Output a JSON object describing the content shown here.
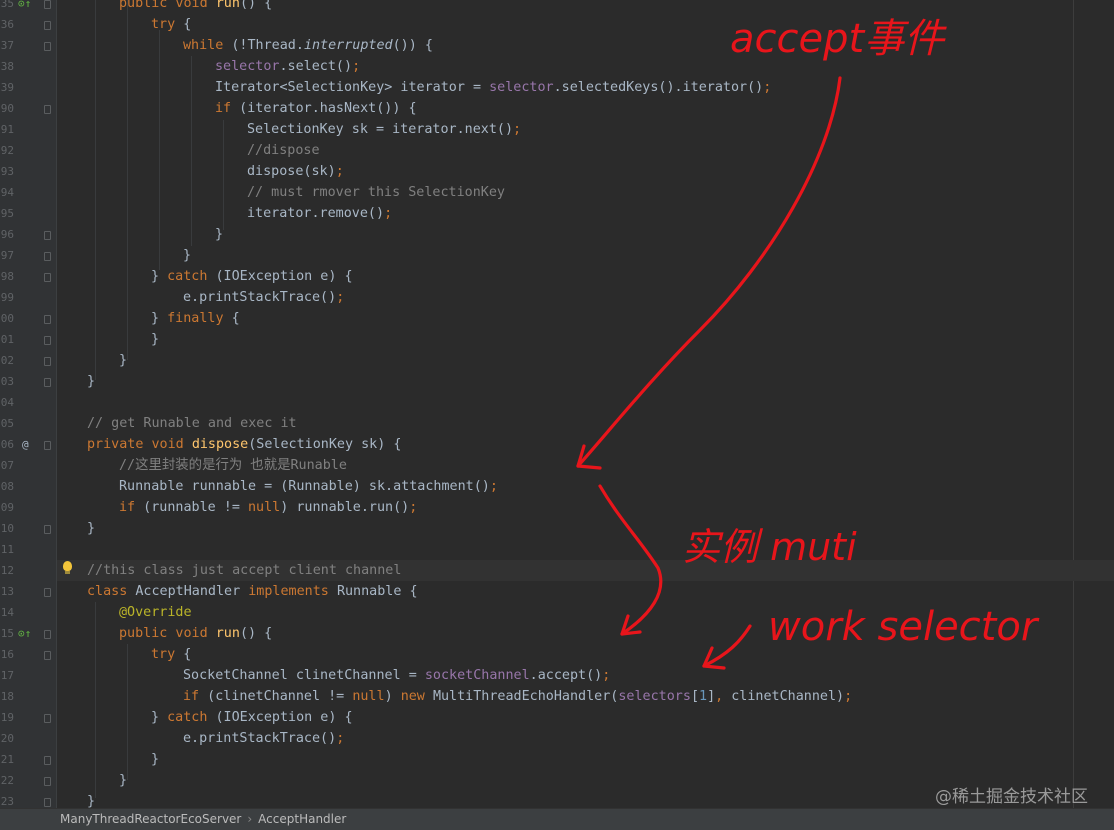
{
  "colors": {
    "background": "#2b2b2b",
    "keyword": "#cc7832",
    "field": "#9876aa",
    "comment": "#808080",
    "annotation": "#bbb529",
    "number": "#6897bb",
    "method_decl": "#ffc66d",
    "handwriting": "#e8151b"
  },
  "gutter": {
    "line_numbers": [
      "35",
      "36",
      "37",
      "38",
      "39",
      "90",
      "91",
      "92",
      "93",
      "94",
      "95",
      "96",
      "97",
      "98",
      "99",
      "00",
      "01",
      "02",
      "03",
      "04",
      "05",
      "06",
      "07",
      "08",
      "09",
      "10",
      "11",
      "12",
      "13",
      "14",
      "15",
      "16",
      "17",
      "18",
      "19",
      "20",
      "21",
      "22",
      "23"
    ],
    "markers": [
      "override-arrow-icon",
      "annotation-at-icon",
      "implementation-arrow-icon"
    ]
  },
  "code": {
    "l0": {
      "a": "public void ",
      "b": "run",
      "c": "() {"
    },
    "l1": {
      "a": "try",
      "b": " {"
    },
    "l2": {
      "a": "while",
      "b": " (!Thread.",
      "c": "interrupted",
      "d": "()) {"
    },
    "l3": {
      "a": "selector",
      "b": ".select()",
      "c": ";"
    },
    "l4": {
      "a": "Iterator<SelectionKey> iterator = ",
      "b": "selector",
      "c": ".selectedKeys().iterator()",
      "d": ";"
    },
    "l5": {
      "a": "if",
      "b": " (iterator.hasNext()) {"
    },
    "l6": {
      "a": "SelectionKey sk = iterator.next()",
      "b": ";"
    },
    "l7": {
      "a": "//dispose"
    },
    "l8": {
      "a": "dispose(sk)",
      "b": ";"
    },
    "l9": {
      "a": "// must rmover this SelectionKey"
    },
    "l10": {
      "a": "iterator.remove()",
      "b": ";"
    },
    "l11": {
      "a": "}"
    },
    "l12": {
      "a": "}"
    },
    "l13": {
      "a": "} ",
      "b": "catch",
      "c": " (IOException e) {"
    },
    "l14": {
      "a": "e.printStackTrace()",
      "b": ";"
    },
    "l15": {
      "a": "} ",
      "b": "finally",
      "c": " {"
    },
    "l16": {
      "a": "}"
    },
    "l17": {
      "a": "}"
    },
    "l18": {
      "a": "}"
    },
    "l19": {
      "a": ""
    },
    "l20": {
      "a": "// get Runable and exec it"
    },
    "l21": {
      "a": "private void ",
      "b": "dispose",
      "c": "(SelectionKey sk) {"
    },
    "l22": {
      "a": "//这里封装的是行为 也就是Runable"
    },
    "l23": {
      "a": "Runnable runnable = (Runnable) sk.attachment()",
      "b": ";"
    },
    "l24": {
      "a": "if",
      "b": " (runnable != ",
      "c": "null",
      "d": ") runnable.run()",
      "e": ";"
    },
    "l25": {
      "a": "}"
    },
    "l26": {
      "a": ""
    },
    "l27": {
      "a": "//this class just accept client channel"
    },
    "l28": {
      "a": "class ",
      "b": "AcceptHandler ",
      "c": "implements ",
      "d": "Runnable {"
    },
    "l29": {
      "a": "@Override"
    },
    "l30": {
      "a": "public void ",
      "b": "run",
      "c": "() {"
    },
    "l31": {
      "a": "try",
      "b": " {"
    },
    "l32": {
      "a": "SocketChannel clinetChannel = ",
      "b": "socketChannel",
      "c": ".accept()",
      "d": ";"
    },
    "l33": {
      "a": "if",
      "b": " (clinetChannel != ",
      "c": "null",
      "d": ") ",
      "e": "new ",
      "f": "MultiThreadEchoHandler(",
      "g": "selectors",
      "h": "[",
      "i": "1",
      "j": "]",
      "k": ", ",
      "l": "clinetChannel)",
      "m": ";"
    },
    "l34": {
      "a": "} ",
      "b": "catch",
      "c": " (IOException e) {"
    },
    "l35": {
      "a": "e.printStackTrace()",
      "b": ";"
    },
    "l36": {
      "a": "}"
    },
    "l37": {
      "a": "}"
    },
    "l38": {
      "a": "}"
    }
  },
  "handwriting": {
    "accept_event": "accept事件",
    "instance_multi": "实例 muti",
    "work_selector": "work selector"
  },
  "statusbar": {
    "breadcrumb": [
      "ManyThreadReactorEcoServer",
      "AcceptHandler"
    ],
    "separator": "›"
  },
  "watermark": "@稀土掘金技术社区"
}
